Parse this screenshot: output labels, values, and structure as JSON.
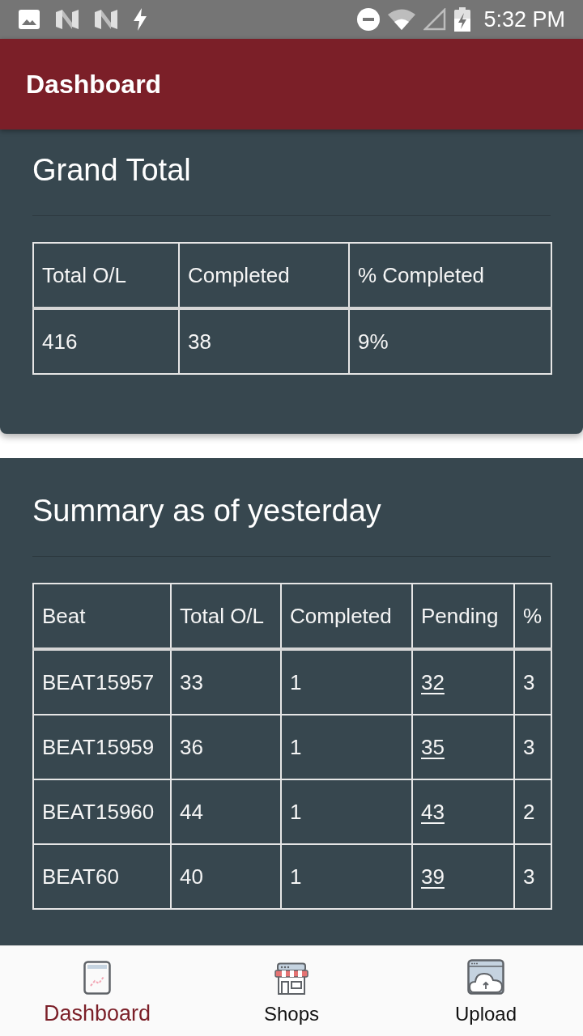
{
  "status_bar": {
    "time": "5:32 PM"
  },
  "app_bar": {
    "title": "Dashboard"
  },
  "grand_total": {
    "title": "Grand Total",
    "columns": [
      "Total O/L",
      "Completed",
      "% Completed"
    ],
    "rows": [
      [
        "416",
        "38",
        "9%"
      ]
    ]
  },
  "summary": {
    "title": "Summary as of yesterday",
    "columns": [
      "Beat",
      "Total O/L",
      "Completed",
      "Pending",
      "%"
    ],
    "rows": [
      {
        "beat": "BEAT15957",
        "total_ol": "33",
        "completed": "1",
        "pending": "32",
        "percent": "3"
      },
      {
        "beat": "BEAT15959",
        "total_ol": "36",
        "completed": "1",
        "pending": "35",
        "percent": "3"
      },
      {
        "beat": "BEAT15960",
        "total_ol": "44",
        "completed": "1",
        "pending": "43",
        "percent": "2"
      },
      {
        "beat": "BEAT60",
        "total_ol": "40",
        "completed": "1",
        "pending": "39",
        "percent": "3"
      }
    ]
  },
  "bottom_nav": [
    {
      "label": "Dashboard",
      "selected": true
    },
    {
      "label": "Shops",
      "selected": false
    },
    {
      "label": "Upload",
      "selected": false
    }
  ]
}
